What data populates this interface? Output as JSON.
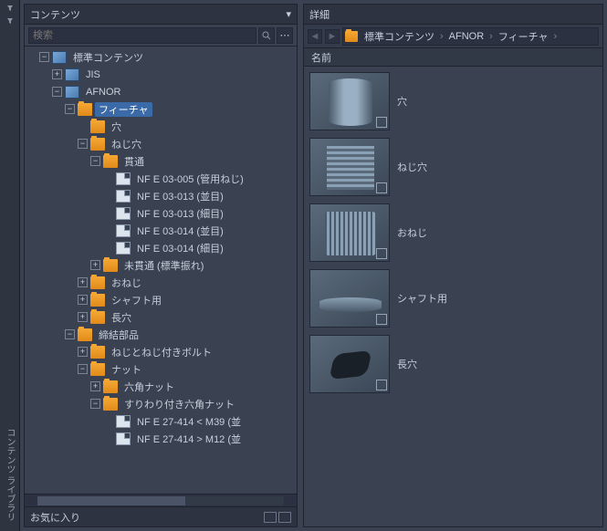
{
  "rail": {
    "label": "コンテンツ ライブラリ"
  },
  "left": {
    "title": "コンテンツ",
    "search_placeholder": "検索",
    "favorites": "お気に入り"
  },
  "tree": {
    "root": "標準コンテンツ",
    "n0": "JIS",
    "n1": "AFNOR",
    "n2": "フィーチャ",
    "n3": "穴",
    "n4": "ねじ穴",
    "n5": "貫通",
    "l0": "NF E 03-005  (管用ねじ)",
    "l1": "NF E 03-013  (並目)",
    "l2": "NF E 03-013  (細目)",
    "l3": "NF E 03-014  (並目)",
    "l4": "NF E 03-014  (細目)",
    "n6": "未貫通 (標準振れ)",
    "n7": "おねじ",
    "n8": "シャフト用",
    "n9": "長穴",
    "n10": "締結部品",
    "n11": "ねじとねじ付きボルト",
    "n12": "ナット",
    "n13": "六角ナット",
    "n14": "すりわり付き六角ナット",
    "l5": "NF E 27-414 < M39  (並",
    "l6": "NF E 27-414 > M12  (並"
  },
  "right": {
    "title": "詳細",
    "crumb": {
      "c0": "標準コンテンツ",
      "c1": "AFNOR",
      "c2": "フィーチャ"
    },
    "colhdr": "名前",
    "items": {
      "i0": "穴",
      "i1": "ねじ穴",
      "i2": "おねじ",
      "i3": "シャフト用",
      "i4": "長穴"
    }
  }
}
